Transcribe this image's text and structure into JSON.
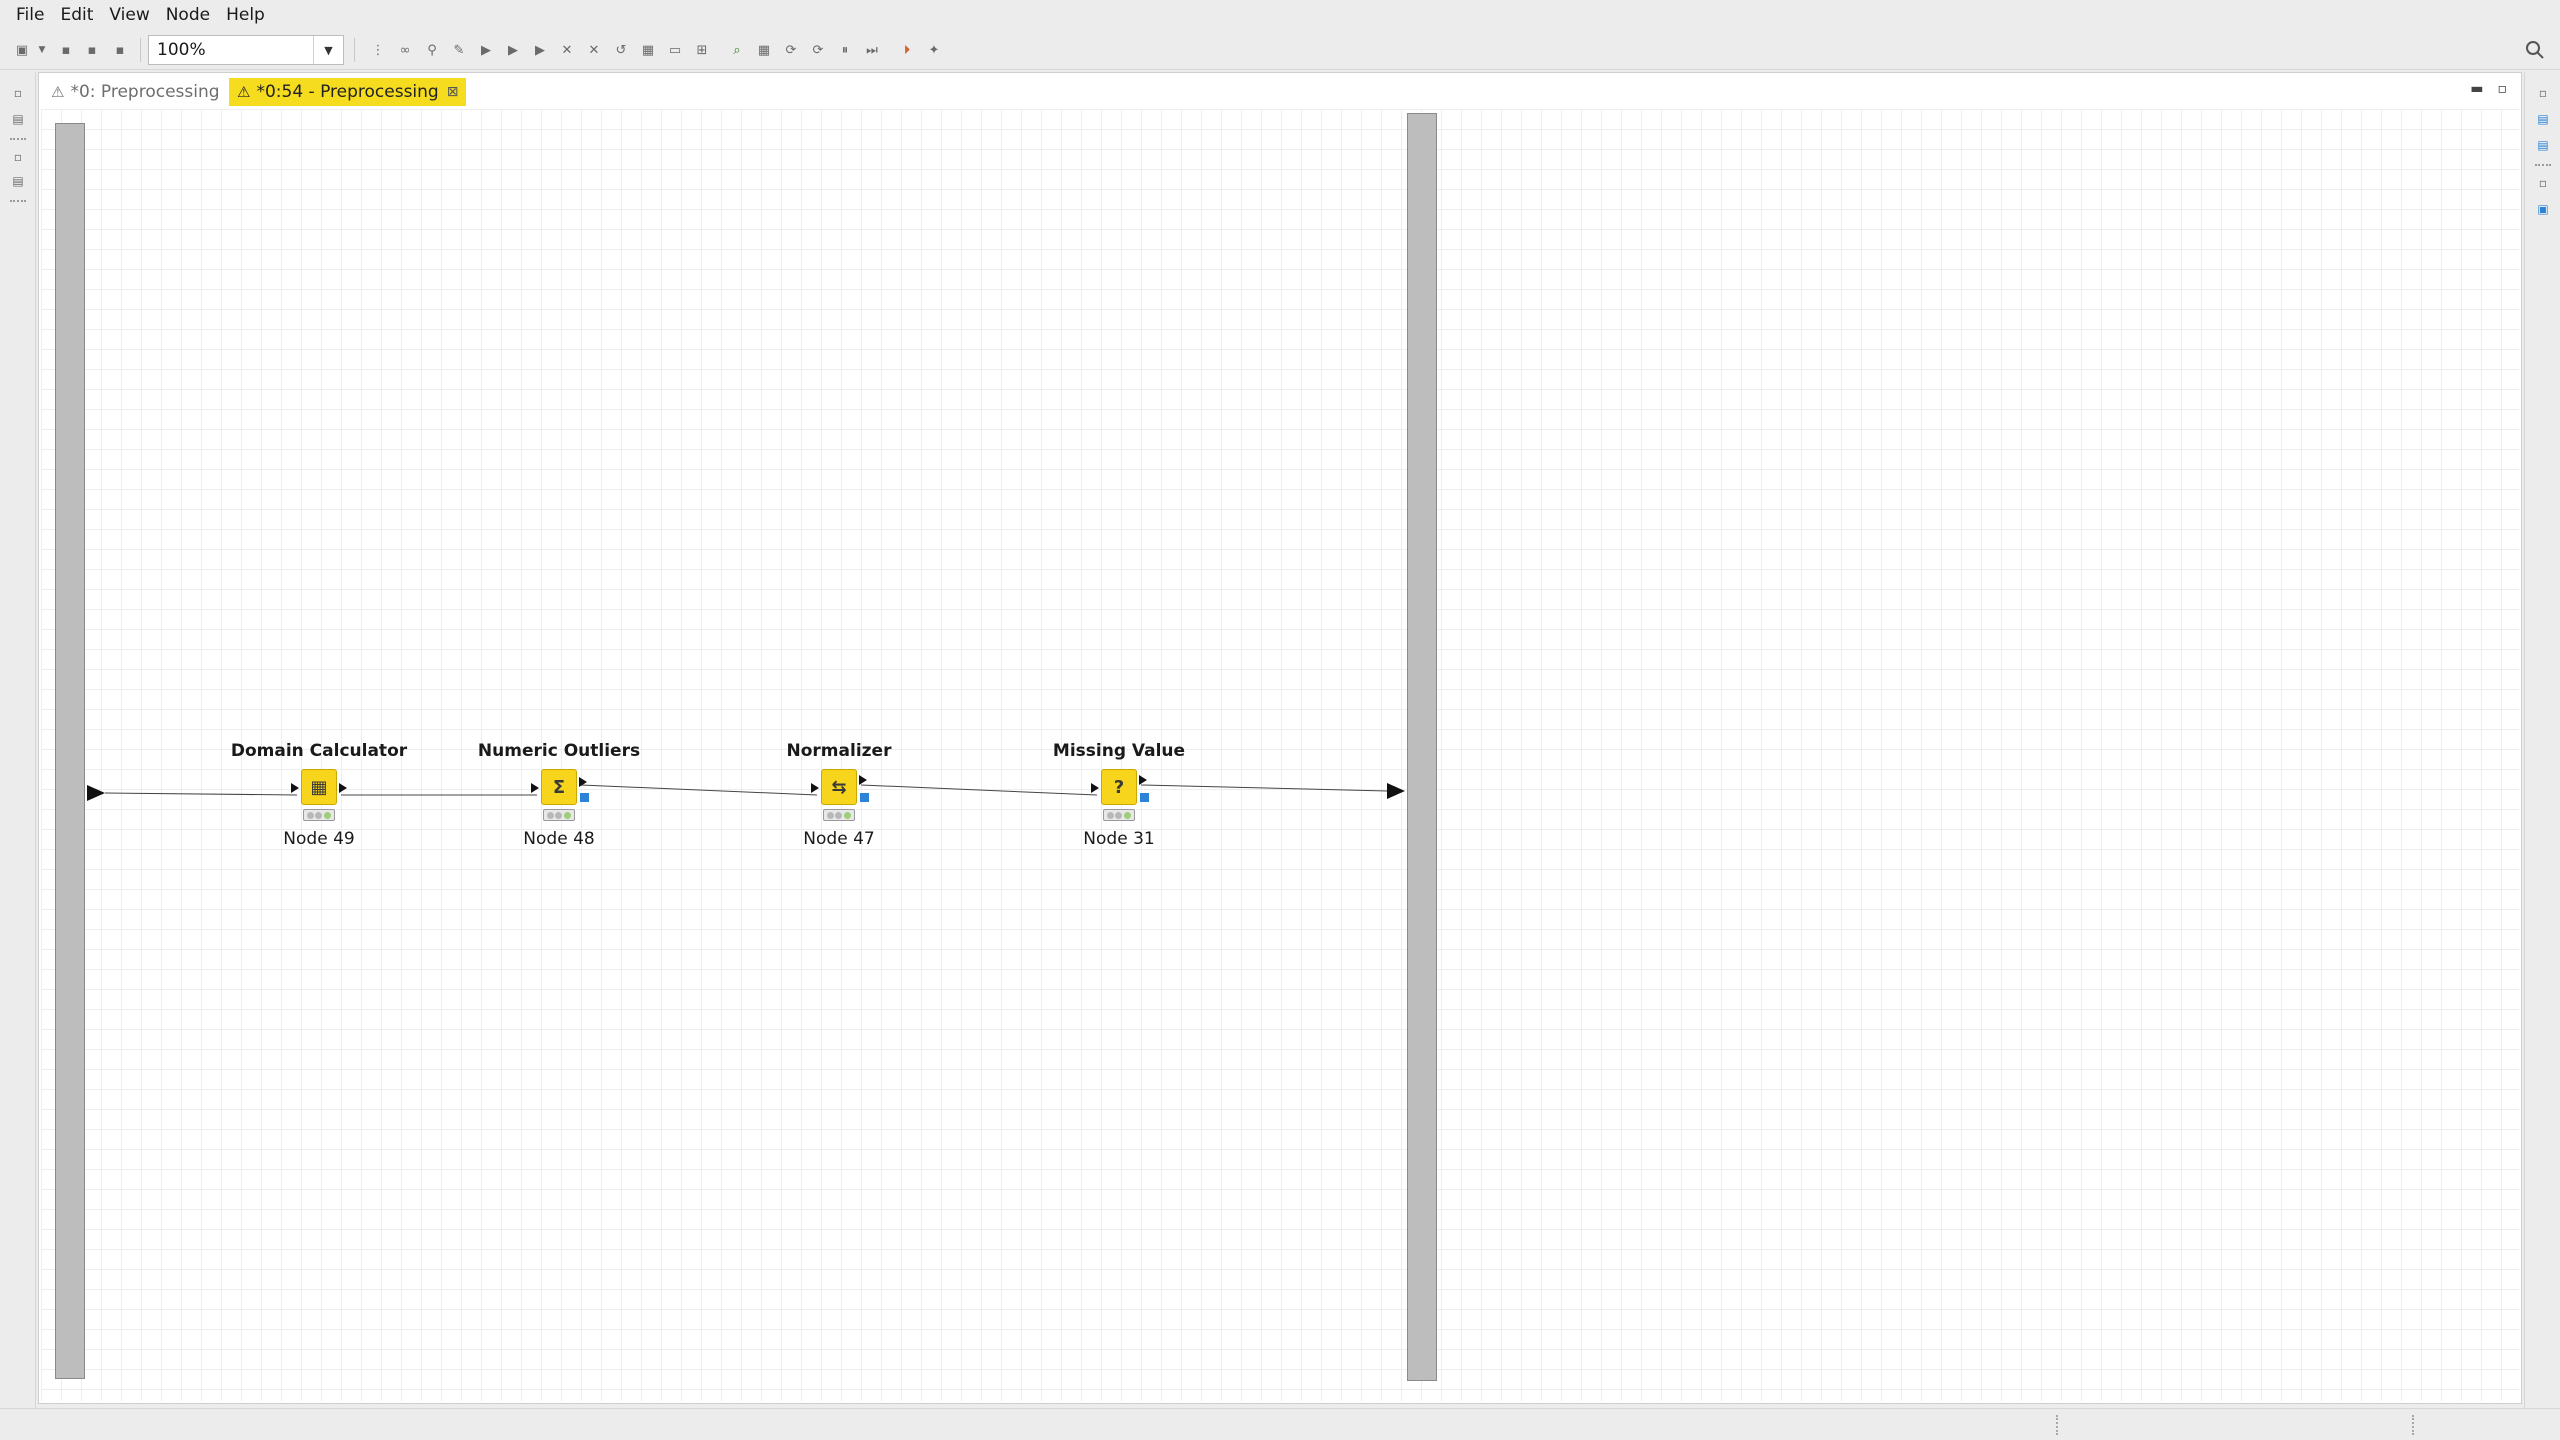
{
  "menu": [
    "File",
    "Edit",
    "View",
    "Node",
    "Help"
  ],
  "toolbar": {
    "zoom_value": "100%",
    "icons": [
      "new-icon",
      "save-icon",
      "save-as-icon",
      "save-all-icon",
      "align-icon",
      "auto-layout-icon",
      "connect-icon",
      "configure-icon",
      "execute-icon",
      "execute-all-icon",
      "execute-open-view-icon",
      "cancel-icon",
      "cancel-all-icon",
      "reset-icon",
      "view-icon",
      "annotation-icon",
      "zoom-fit-icon",
      "zoom-icon",
      "grid-icon",
      "loop-icon",
      "loop-step-icon",
      "pause-icon",
      "step-icon",
      "resume-icon",
      "wrench-icon",
      "layout-icon"
    ]
  },
  "tabs": [
    {
      "label": "*0: Preprocessing",
      "active": false
    },
    {
      "label": "*0:54 - Preprocessing",
      "active": true
    }
  ],
  "nodes": [
    {
      "title": "Domain Calculator",
      "label": "Node 49",
      "icon": "table-icon",
      "glyph": "▦",
      "model_port": false
    },
    {
      "title": "Numeric Outliers",
      "label": "Node 48",
      "icon": "sigma-icon",
      "glyph": "Σ",
      "model_port": true
    },
    {
      "title": "Normalizer",
      "label": "Node 47",
      "icon": "normalize-icon",
      "glyph": "⇆",
      "model_port": true
    },
    {
      "title": "Missing Value",
      "label": "Node 31",
      "icon": "question-icon",
      "glyph": "?",
      "model_port": true
    }
  ],
  "colors": {
    "active_tab": "#f5dc1e",
    "node_body": "#f6d51c",
    "model_port": "#2a83d6",
    "metanode_bar": "#bdbdbd"
  }
}
